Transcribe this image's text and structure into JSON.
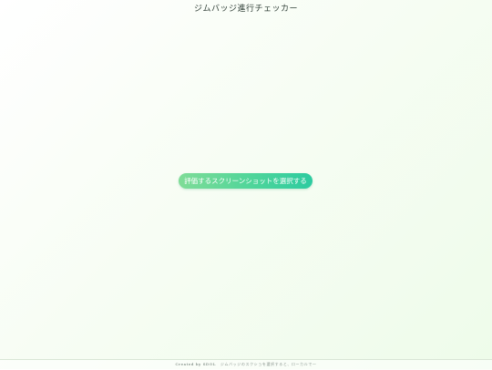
{
  "header": {
    "title": "ジムバッジ進行チェッカー"
  },
  "main": {
    "select_button_label": "評価するスクリーンショットを選択する"
  },
  "footer": {
    "credit": "Created by SDOL",
    "note": "ジムバッジのスクショを選択すると、ローカルで一"
  },
  "colors": {
    "button_gradient_start": "#7fdc97",
    "button_gradient_end": "#2dcba0",
    "background_tint": "#eefcea"
  }
}
